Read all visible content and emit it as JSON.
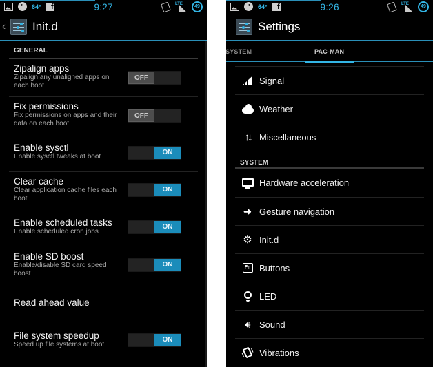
{
  "left": {
    "status_bar": {
      "time": "9:27",
      "temperature": "64°",
      "battery": "49",
      "network": "LTE"
    },
    "action_bar": {
      "title": "Init.d",
      "back": "‹"
    },
    "section": "GENERAL",
    "items": [
      {
        "title": "Zipalign apps",
        "summary": "Zipalign any unaligned apps on each boot",
        "toggle": "OFF"
      },
      {
        "title": "Fix permissions",
        "summary": "Fix permissions on apps and their data on each boot",
        "toggle": "OFF"
      },
      {
        "title": "Enable sysctl",
        "summary": "Enable sysctl tweaks at boot",
        "toggle": "ON"
      },
      {
        "title": "Clear cache",
        "summary": "Clear application cache files each boot",
        "toggle": "ON"
      },
      {
        "title": "Enable scheduled tasks",
        "summary": "Enable scheduled cron jobs",
        "toggle": "ON"
      },
      {
        "title": "Enable SD boost",
        "summary": "Enable/disable SD card speed boost",
        "toggle": "ON"
      },
      {
        "title": "Read ahead value",
        "summary": "",
        "toggle": null
      },
      {
        "title": "File system speedup",
        "summary": "Speed up file systems at boot",
        "toggle": "ON"
      }
    ]
  },
  "right": {
    "status_bar": {
      "time": "9:26",
      "temperature": "64°",
      "battery": "49",
      "network": "LTE"
    },
    "action_bar": {
      "title": "Settings"
    },
    "tabs": [
      {
        "label": "SYSTEM",
        "active": false
      },
      {
        "label": "PAC-MAN",
        "active": true
      }
    ],
    "top_items": [
      {
        "label": "Signal",
        "icon": "signal-icon"
      },
      {
        "label": "Weather",
        "icon": "cloud-icon"
      },
      {
        "label": "Miscellaneous",
        "icon": "up-down-arrows-icon"
      }
    ],
    "section": "SYSTEM",
    "system_items": [
      {
        "label": "Hardware acceleration",
        "icon": "monitor-icon"
      },
      {
        "label": "Gesture navigation",
        "icon": "arrow-right-icon"
      },
      {
        "label": "Init.d",
        "icon": "gears-icon"
      },
      {
        "label": "Buttons",
        "icon": "fn-key-icon"
      },
      {
        "label": "LED",
        "icon": "lightbulb-icon"
      },
      {
        "label": "Sound",
        "icon": "speaker-icon"
      },
      {
        "label": "Vibrations",
        "icon": "vibrate-icon"
      }
    ]
  },
  "accent_color": "#33b5e5",
  "toggle_on_color": "#1b8cba"
}
